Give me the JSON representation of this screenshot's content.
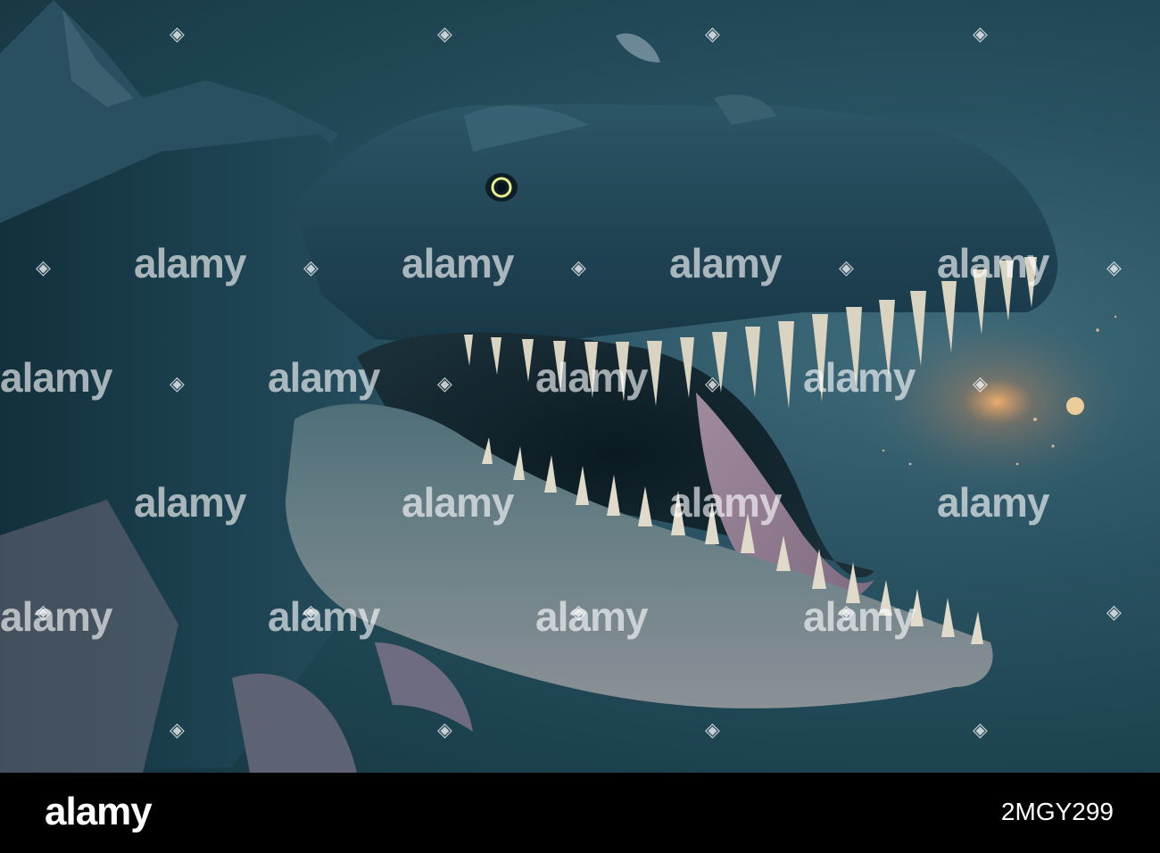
{
  "image": {
    "subject": "dinosaur-head",
    "background_color": "#1d4350",
    "accent_glow_color": "#ffb56b"
  },
  "watermark": {
    "word": "alamy",
    "icon": "alamy-mark-icon",
    "color": "#ffffff"
  },
  "footer": {
    "logo": "alamy",
    "image_id": "2MGY299",
    "text": "",
    "background_color": "#000000"
  }
}
